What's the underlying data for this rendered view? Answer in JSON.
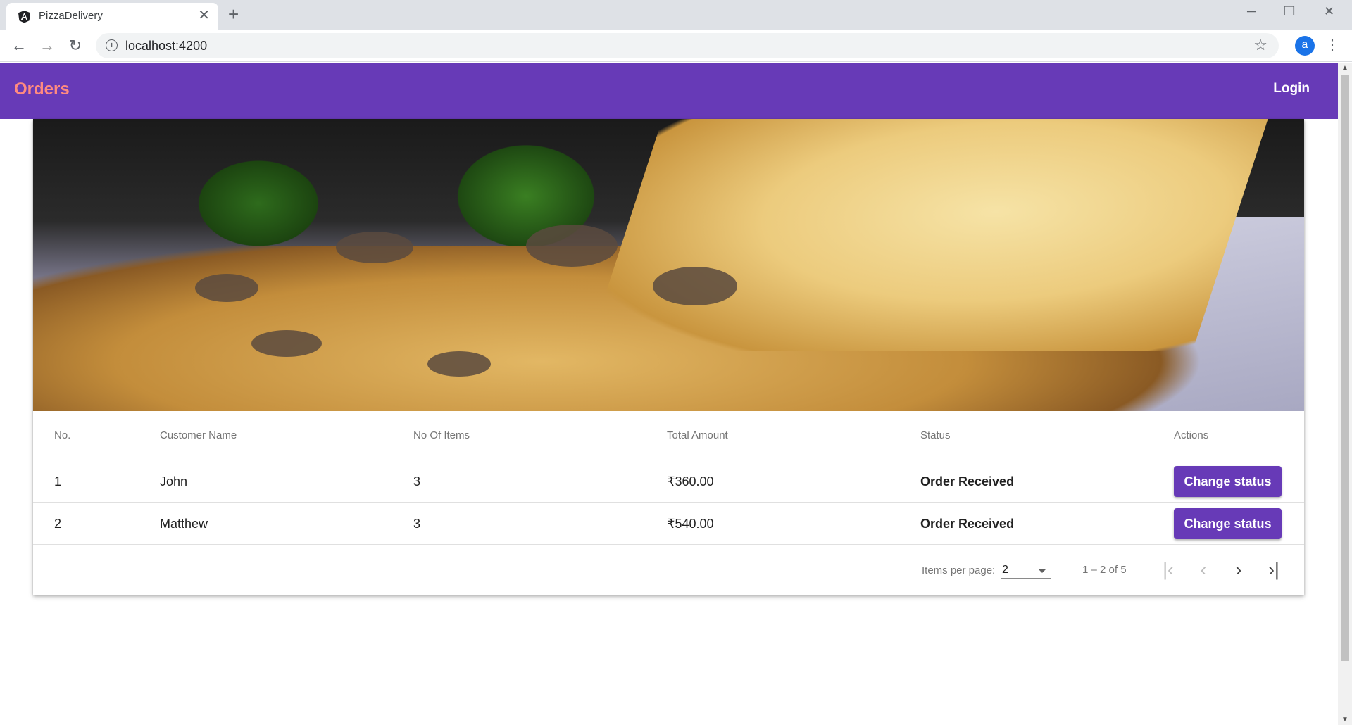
{
  "browser": {
    "tab_title": "PizzaDelivery",
    "url": "localhost:4200",
    "avatar_letter": "a",
    "new_tab_glyph": "+",
    "close_glyph": "✕",
    "minimize_glyph": "─",
    "restore_glyph": "❐",
    "close_window_glyph": "✕",
    "back_glyph": "←",
    "forward_glyph": "→",
    "reload_glyph": "↻",
    "star_glyph": "☆",
    "menu_glyph": "⋮"
  },
  "appbar": {
    "title": "Orders",
    "login_label": "Login",
    "background": "#673ab7",
    "title_color": "#ff8a80"
  },
  "table": {
    "headers": {
      "no": "No.",
      "customer": "Customer Name",
      "items": "No Of Items",
      "amount": "Total Amount",
      "status": "Status",
      "actions": "Actions"
    },
    "rows": [
      {
        "no": "1",
        "customer": "John",
        "items": "3",
        "amount": "₹360.00",
        "status": "Order Received",
        "action": "Change status"
      },
      {
        "no": "2",
        "customer": "Matthew",
        "items": "3",
        "amount": "₹540.00",
        "status": "Order Received",
        "action": "Change status"
      }
    ]
  },
  "paginator": {
    "items_per_page_label": "Items per page:",
    "items_per_page_value": "2",
    "range_label": "1 – 2 of 5",
    "first_glyph": "|‹",
    "prev_glyph": "‹",
    "next_glyph": "›",
    "last_glyph": "›|"
  }
}
